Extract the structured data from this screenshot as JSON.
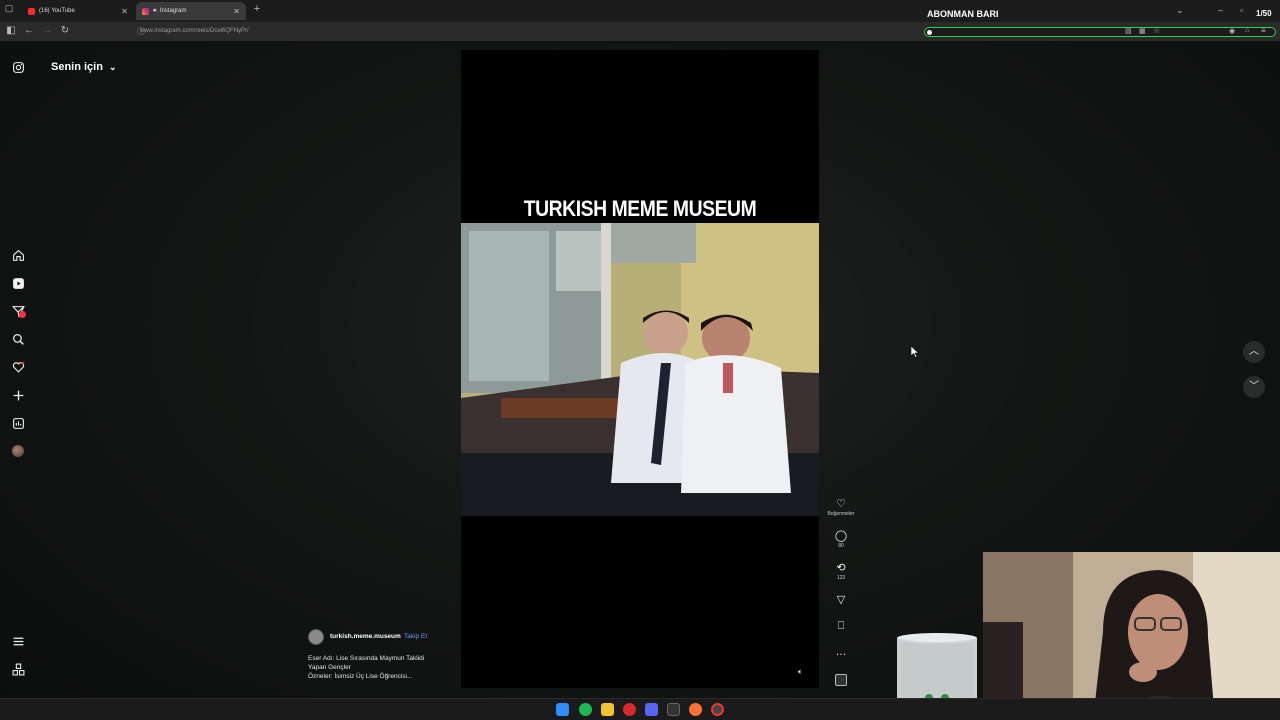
{
  "browser": {
    "tabs": [
      {
        "title": "(16) YouTube",
        "active": false
      },
      {
        "title": "Instagram",
        "active": true
      }
    ],
    "url": "www.instagram.com/reels/Dcel6QFNyPr/"
  },
  "overlay": {
    "title": "ABONMAN BARI",
    "counter": "1/50",
    "progress": 0.02
  },
  "instagram": {
    "feed_title": "Senin için",
    "reel": {
      "caption_overlay": "TURKISH MEME MUSEUM",
      "author": "turkish.meme.museum",
      "separator": "•",
      "follow_label": "Takip Et",
      "description_line1": "Eser Adı: Lise Sırasında Maymun Taklidi",
      "description_line2": "Yapan Gençler",
      "description_line3": "Özneler: İsimsiz Üç Lise Öğrencisi..."
    },
    "actions": {
      "likes_label": "Beğenmeler",
      "comments": "80",
      "reposts": "123"
    }
  },
  "colors": {
    "progress_border": "#2dd24c",
    "follow_link": "#6d9bff",
    "notification_badge": "#ff3040"
  }
}
